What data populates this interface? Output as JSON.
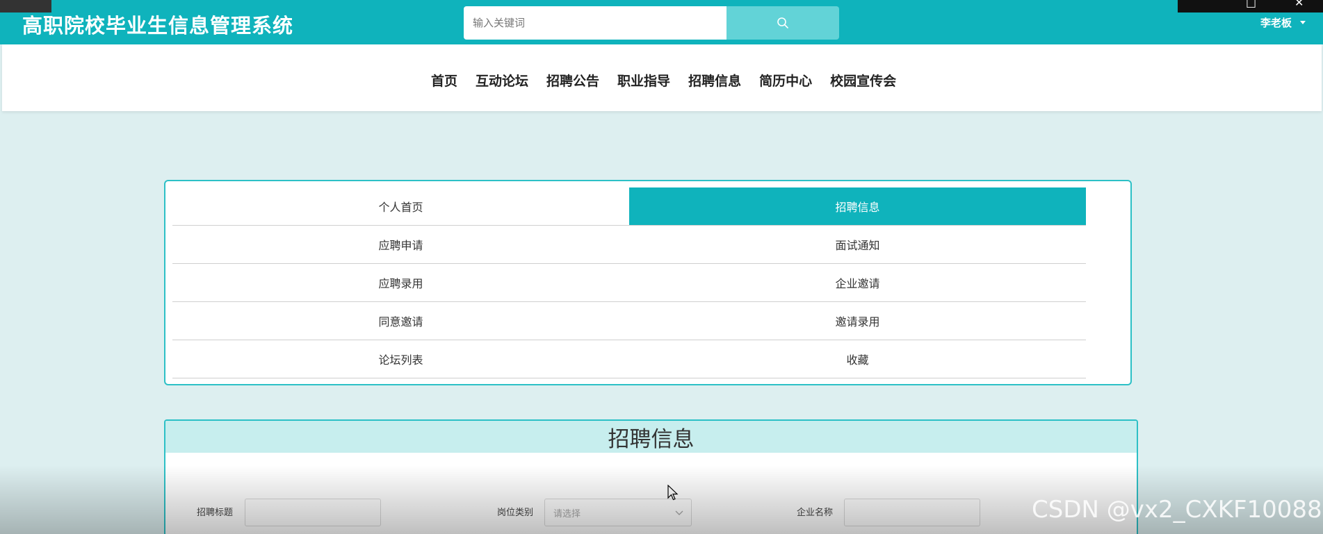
{
  "header": {
    "site_title": "高职院校毕业生信息管理系统",
    "search_placeholder": "输入关键词",
    "search_icon": "search-icon",
    "user_name": "李老板"
  },
  "nav": {
    "items": [
      {
        "label": "首页"
      },
      {
        "label": "互动论坛"
      },
      {
        "label": "招聘公告"
      },
      {
        "label": "职业指导"
      },
      {
        "label": "招聘信息"
      },
      {
        "label": "简历中心"
      },
      {
        "label": "校园宣传会"
      }
    ]
  },
  "user_menu": {
    "active": "招聘信息",
    "items": [
      {
        "label": "个人首页"
      },
      {
        "label": "招聘信息"
      },
      {
        "label": "应聘申请"
      },
      {
        "label": "面试通知"
      },
      {
        "label": "应聘录用"
      },
      {
        "label": "企业邀请"
      },
      {
        "label": "同意邀请"
      },
      {
        "label": "邀请录用"
      },
      {
        "label": "论坛列表"
      },
      {
        "label": "收藏"
      }
    ]
  },
  "panel": {
    "title": "招聘信息",
    "filters": {
      "title_label": "招聘标题",
      "category_label": "岗位类别",
      "category_placeholder": "请选择",
      "company_label": "企业名称"
    }
  },
  "watermark": "CSDN @vx2_CXKF10088",
  "colors": {
    "primary": "#0fb3bc",
    "search_button": "#62d3d7",
    "panel_header": "#c7eeee",
    "page_background": "#ddeff0"
  }
}
